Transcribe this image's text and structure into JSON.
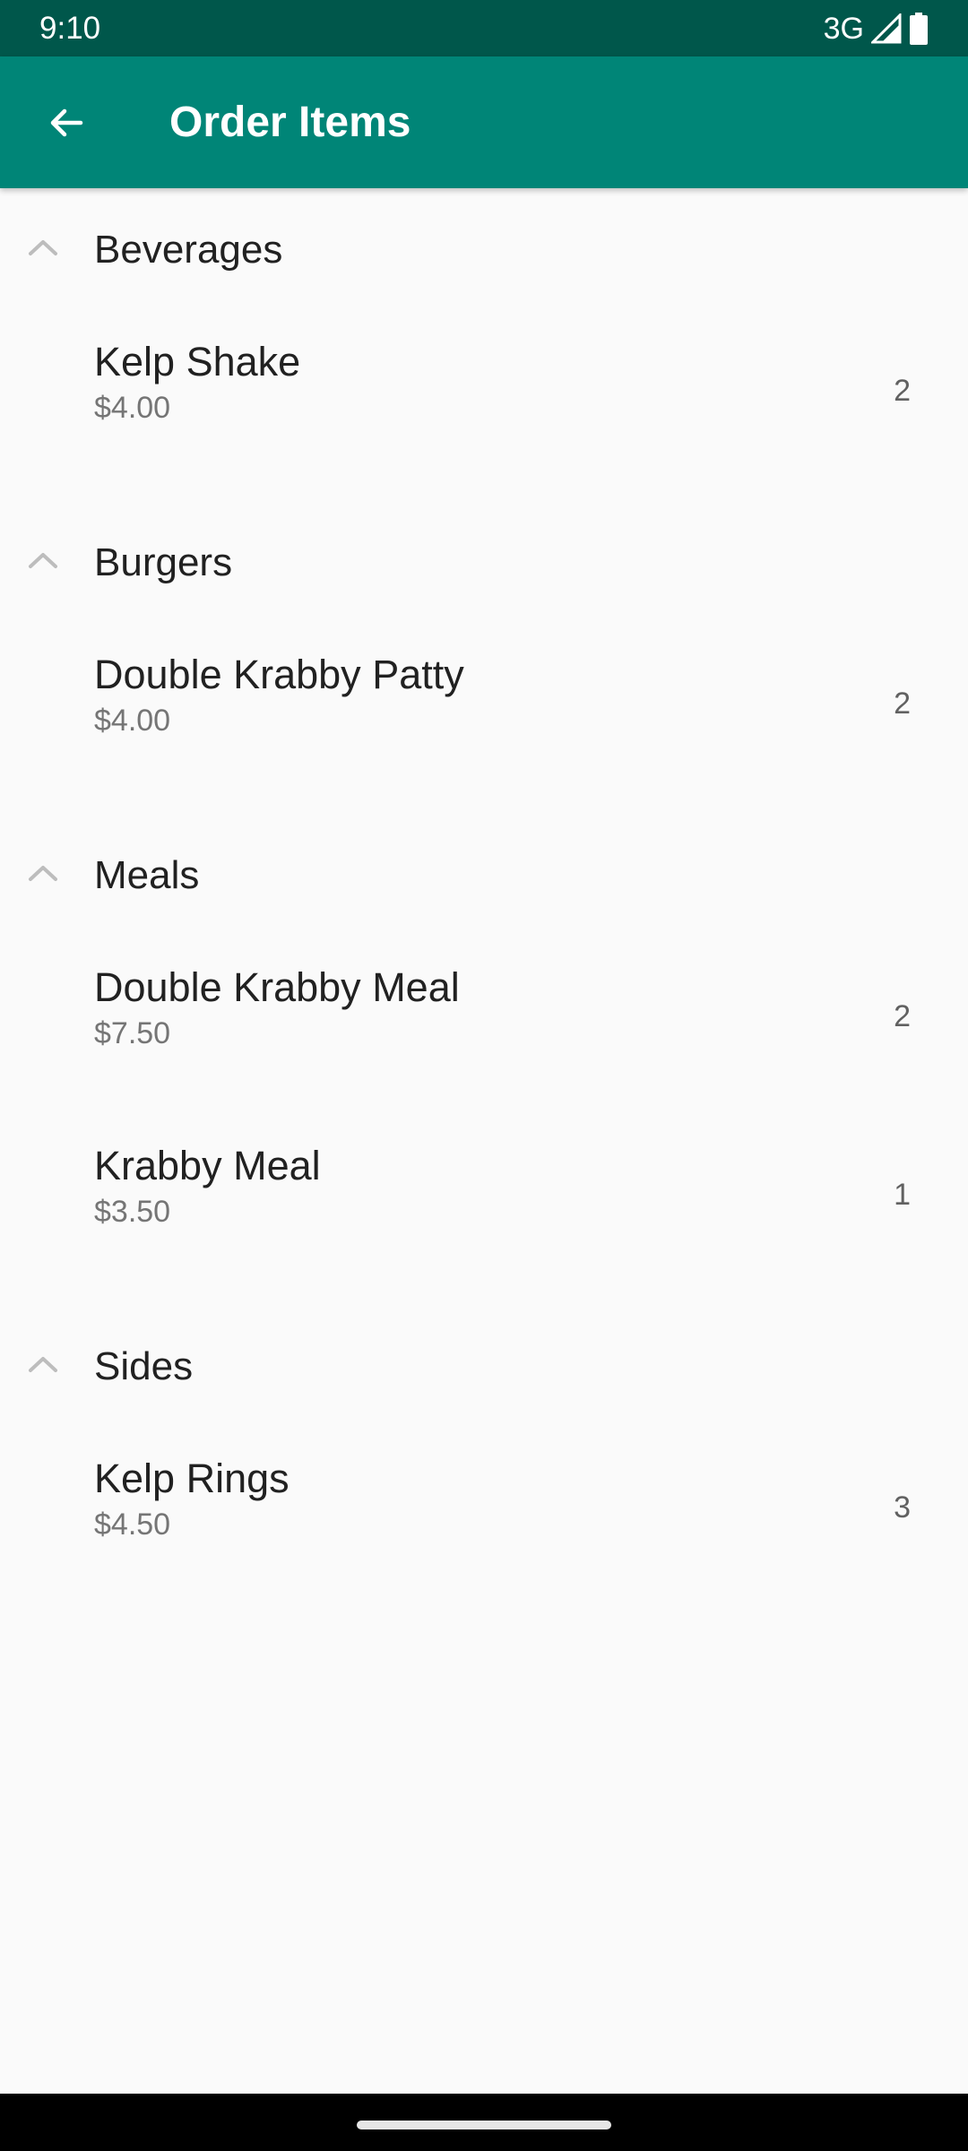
{
  "status_bar": {
    "time": "9:10",
    "network": "3G"
  },
  "app_bar": {
    "title": "Order Items",
    "back_icon": "arrow-back-icon"
  },
  "colors": {
    "status_bar": "#00574b",
    "app_bar": "#008577",
    "background": "#fafafa"
  },
  "groups": [
    {
      "title": "Beverages",
      "expanded": true,
      "items": [
        {
          "name": "Kelp Shake",
          "price": "$4.00",
          "qty": "2"
        }
      ]
    },
    {
      "title": "Burgers",
      "expanded": true,
      "items": [
        {
          "name": "Double Krabby Patty",
          "price": "$4.00",
          "qty": "2"
        }
      ]
    },
    {
      "title": "Meals",
      "expanded": true,
      "items": [
        {
          "name": "Double Krabby Meal",
          "price": "$7.50",
          "qty": "2"
        },
        {
          "name": "Krabby Meal",
          "price": "$3.50",
          "qty": "1"
        }
      ]
    },
    {
      "title": "Sides",
      "expanded": true,
      "items": [
        {
          "name": "Kelp Rings",
          "price": "$4.50",
          "qty": "3"
        }
      ]
    }
  ]
}
